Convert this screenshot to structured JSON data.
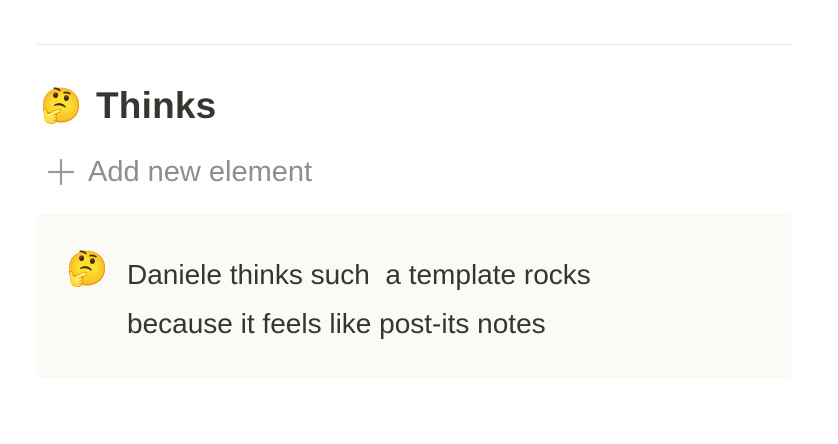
{
  "section": {
    "emoji": "🤔",
    "emoji_icon": "thinking-face-icon",
    "title": "Thinks"
  },
  "add_element": {
    "icon": "plus-icon",
    "label": "Add new element"
  },
  "callout": {
    "emoji": "🤔",
    "emoji_icon": "thinking-face-icon",
    "text": "Daniele thinks such  a template rocks\nbecause it feels like post-its notes"
  }
}
